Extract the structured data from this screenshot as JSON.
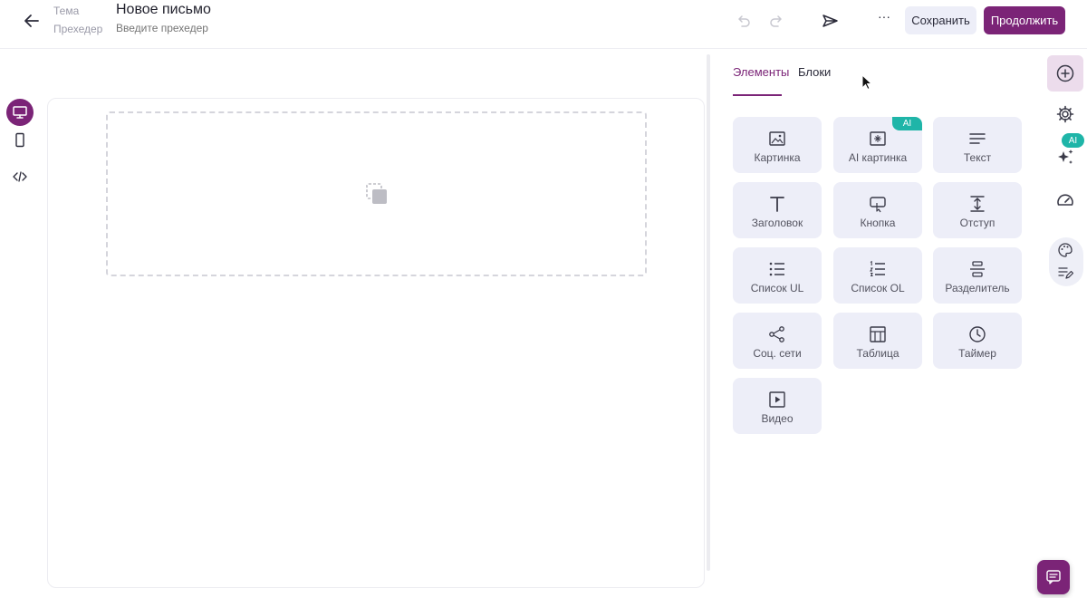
{
  "header": {
    "theme_label": "Тема",
    "subject": "Новое письмо",
    "preheader_label": "Прехедер",
    "preheader_placeholder": "Введите прехедер",
    "more_label": "···",
    "save_label": "Сохранить",
    "continue_label": "Продолжить"
  },
  "panel": {
    "tabs": [
      {
        "label": "Элементы",
        "active": true
      },
      {
        "label": "Блоки",
        "active": false
      }
    ],
    "elements": [
      {
        "label": "Картинка",
        "icon": "image-icon"
      },
      {
        "label": "AI картинка",
        "icon": "ai-image-icon",
        "badge": "AI"
      },
      {
        "label": "Текст",
        "icon": "text-lines-icon"
      },
      {
        "label": "Заголовок",
        "icon": "heading-icon"
      },
      {
        "label": "Кнопка",
        "icon": "button-icon"
      },
      {
        "label": "Отступ",
        "icon": "spacer-icon"
      },
      {
        "label": "Список UL",
        "icon": "bullet-list-icon"
      },
      {
        "label": "Список OL",
        "icon": "numbered-list-icon"
      },
      {
        "label": "Разделитель",
        "icon": "divider-icon"
      },
      {
        "label": "Соц. сети",
        "icon": "share-icon"
      },
      {
        "label": "Таблица",
        "icon": "table-icon"
      },
      {
        "label": "Таймер",
        "icon": "clock-icon"
      },
      {
        "label": "Видео",
        "icon": "video-icon"
      }
    ]
  },
  "right_rail": {
    "ai_badge": "AI"
  },
  "colors": {
    "accent": "#7b2477",
    "ai_badge": "#1fb5a8",
    "card_bg": "#edeef8"
  }
}
